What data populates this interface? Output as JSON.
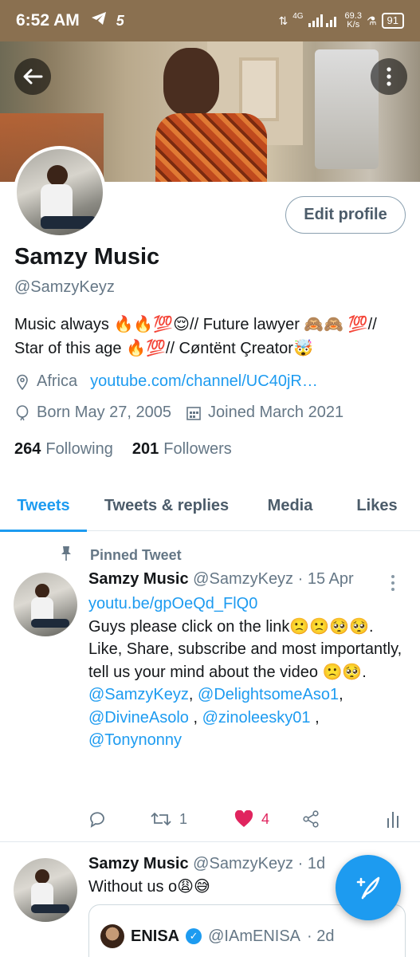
{
  "statusbar": {
    "time": "6:52 AM",
    "network": "4G",
    "speed_value": "69.3",
    "speed_unit": "K/s",
    "battery": "91"
  },
  "profile": {
    "edit_label": "Edit profile",
    "name": "Samzy Music",
    "handle": "@SamzyKeyz",
    "bio": "Music always 🔥🔥💯😌//  Future lawyer 🙈🙈 💯//  Star of this age 🔥💯//  Cøntënt Çreator🤯",
    "location": "Africa",
    "website": "youtube.com/channel/UC40jR…",
    "born": "Born May 27, 2005",
    "joined": "Joined March 2021",
    "following_count": "264",
    "following_label": "Following",
    "followers_count": "201",
    "followers_label": "Followers"
  },
  "tabs": [
    {
      "label": "Tweets",
      "active": true
    },
    {
      "label": "Tweets & replies",
      "active": false
    },
    {
      "label": "Media",
      "active": false
    },
    {
      "label": "Likes",
      "active": false
    }
  ],
  "tweets": [
    {
      "pinned_label": "Pinned Tweet",
      "name": "Samzy Music",
      "handle": "@SamzyKeyz",
      "time": "· 15 Apr",
      "link": "youtu.be/gpOeQd_FlQ0",
      "line1": "  Guys please click on the link🙁🙁🥺🥺.",
      "line2": " Like, Share, subscribe and most importantly, tell us your mind about the video 🙁🥺.",
      "mention1": "@SamzyKeyz",
      "mention2": "@DelightsomeAso1",
      "mention3": "@DivineAsolo",
      "mention4": "@zinoleesky01",
      "mention5": "@Tonynonny",
      "retweets": "1",
      "likes": "4",
      "like_color": "#e0245e"
    },
    {
      "name": "Samzy Music",
      "handle": "@SamzyKeyz",
      "time": "· 1d",
      "text": "Without us o😩😅",
      "quote_name": "ENISA",
      "quote_handle": "@IAmENISA",
      "quote_time": "· 2d"
    }
  ],
  "colors": {
    "accent": "#1d9bf0",
    "muted": "#657786"
  }
}
